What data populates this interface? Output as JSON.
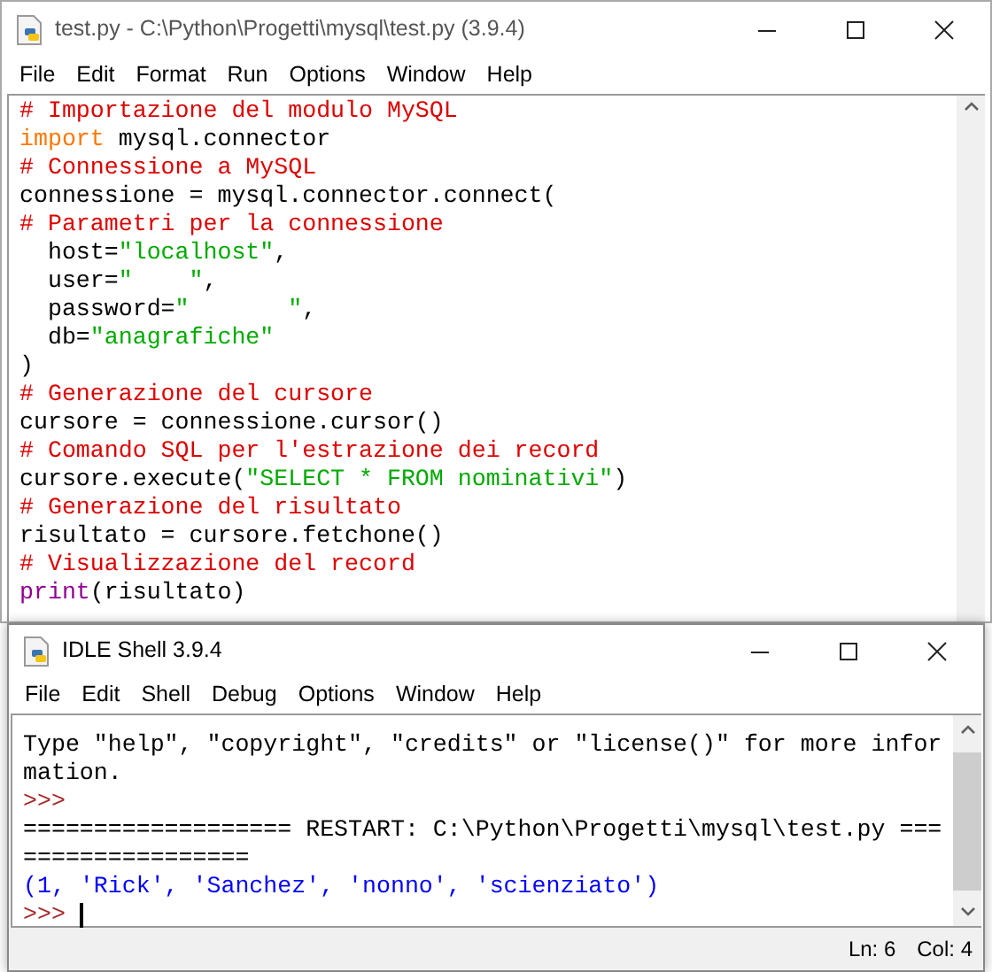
{
  "editor": {
    "title": "test.py - C:\\Python\\Progetti\\mysql\\test.py (3.9.4)",
    "menu": [
      "File",
      "Edit",
      "Format",
      "Run",
      "Options",
      "Window",
      "Help"
    ],
    "lines": [
      [
        {
          "kind": "comment",
          "text": "# Importazione del modulo MySQL"
        }
      ],
      [
        {
          "kind": "keyword",
          "text": "import"
        },
        {
          "kind": "plain",
          "text": " mysql.connector"
        }
      ],
      [
        {
          "kind": "comment",
          "text": "# Connessione a MySQL"
        }
      ],
      [
        {
          "kind": "plain",
          "text": "connessione = mysql.connector.connect("
        }
      ],
      [
        {
          "kind": "comment",
          "text": "# Parametri per la connessione"
        }
      ],
      [
        {
          "kind": "plain",
          "text": "  host="
        },
        {
          "kind": "string",
          "text": "\"localhost\""
        },
        {
          "kind": "plain",
          "text": ","
        }
      ],
      [
        {
          "kind": "plain",
          "text": "  user="
        },
        {
          "kind": "string",
          "text": "\"    \""
        },
        {
          "kind": "plain",
          "text": ","
        }
      ],
      [
        {
          "kind": "plain",
          "text": "  password="
        },
        {
          "kind": "string",
          "text": "\"       \""
        },
        {
          "kind": "plain",
          "text": ","
        }
      ],
      [
        {
          "kind": "plain",
          "text": "  db="
        },
        {
          "kind": "string",
          "text": "\"anagrafiche\""
        }
      ],
      [
        {
          "kind": "plain",
          "text": ")"
        }
      ],
      [
        {
          "kind": "comment",
          "text": "# Generazione del cursore"
        }
      ],
      [
        {
          "kind": "plain",
          "text": "cursore = connessione.cursor()"
        }
      ],
      [
        {
          "kind": "comment",
          "text": "# Comando SQL per l'estrazione dei record"
        }
      ],
      [
        {
          "kind": "plain",
          "text": "cursore.execute("
        },
        {
          "kind": "string",
          "text": "\"SELECT * FROM nominativi\""
        },
        {
          "kind": "plain",
          "text": ")"
        }
      ],
      [
        {
          "kind": "comment",
          "text": "# Generazione del risultato"
        }
      ],
      [
        {
          "kind": "plain",
          "text": "risultato = cursore.fetchone()"
        }
      ],
      [
        {
          "kind": "comment",
          "text": "# Visualizzazione del record"
        }
      ],
      [
        {
          "kind": "builtin",
          "text": "print"
        },
        {
          "kind": "plain",
          "text": "(risultato)"
        }
      ]
    ]
  },
  "shell": {
    "title": "IDLE Shell 3.9.4",
    "menu": [
      "File",
      "Edit",
      "Shell",
      "Debug",
      "Options",
      "Window",
      "Help"
    ],
    "lines": [
      [
        {
          "kind": "plain",
          "text": "Type \"help\", \"copyright\", \"credits\" or \"license()\" for more infor"
        }
      ],
      [
        {
          "kind": "plain",
          "text": "mation."
        }
      ],
      [
        {
          "kind": "prompt",
          "text": ">>>"
        }
      ],
      [
        {
          "kind": "plain",
          "text": "=================== RESTART: C:\\Python\\Progetti\\mysql\\test.py ==="
        }
      ],
      [
        {
          "kind": "plain",
          "text": "================"
        }
      ],
      [
        {
          "kind": "output",
          "text": "(1, 'Rick', 'Sanchez', 'nonno', 'scienziato')"
        }
      ],
      [
        {
          "kind": "prompt",
          "text": ">>> "
        }
      ]
    ],
    "status": {
      "line": "Ln: 6",
      "column": "Col: 4"
    }
  }
}
